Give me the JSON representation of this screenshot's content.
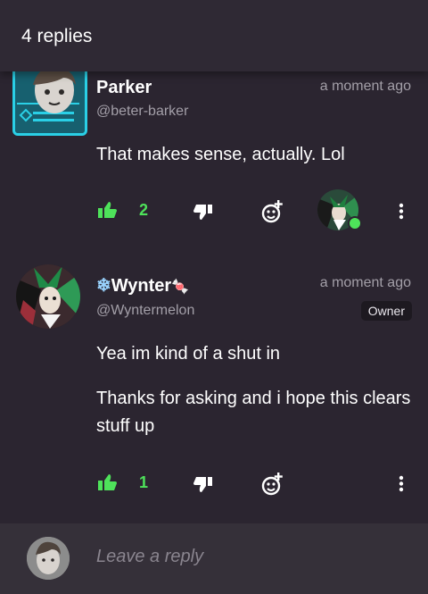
{
  "header": {
    "title": "4 replies"
  },
  "comments": [
    {
      "name": "Parker",
      "handle": "@beter-barker",
      "time": "a moment ago",
      "text": [
        "That makes sense, actually. Lol"
      ],
      "likes": "2"
    },
    {
      "name_prefix": "❄",
      "name": "Wynter",
      "name_suffix": "🍬",
      "handle": "@Wyntermelon",
      "time": "a moment ago",
      "badge": "Owner",
      "text": [
        "Yea im kind of a shut in",
        "Thanks for asking and i hope this clears stuff up"
      ],
      "likes": "1"
    }
  ],
  "reply": {
    "placeholder": "Leave a reply"
  },
  "colors": {
    "accent_green": "#4ee25a",
    "background": "#2b2530",
    "muted": "#a39fa8"
  },
  "icons": [
    "thumbs-up-icon",
    "thumbs-down-icon",
    "add-reaction-icon",
    "more-vertical-icon"
  ]
}
